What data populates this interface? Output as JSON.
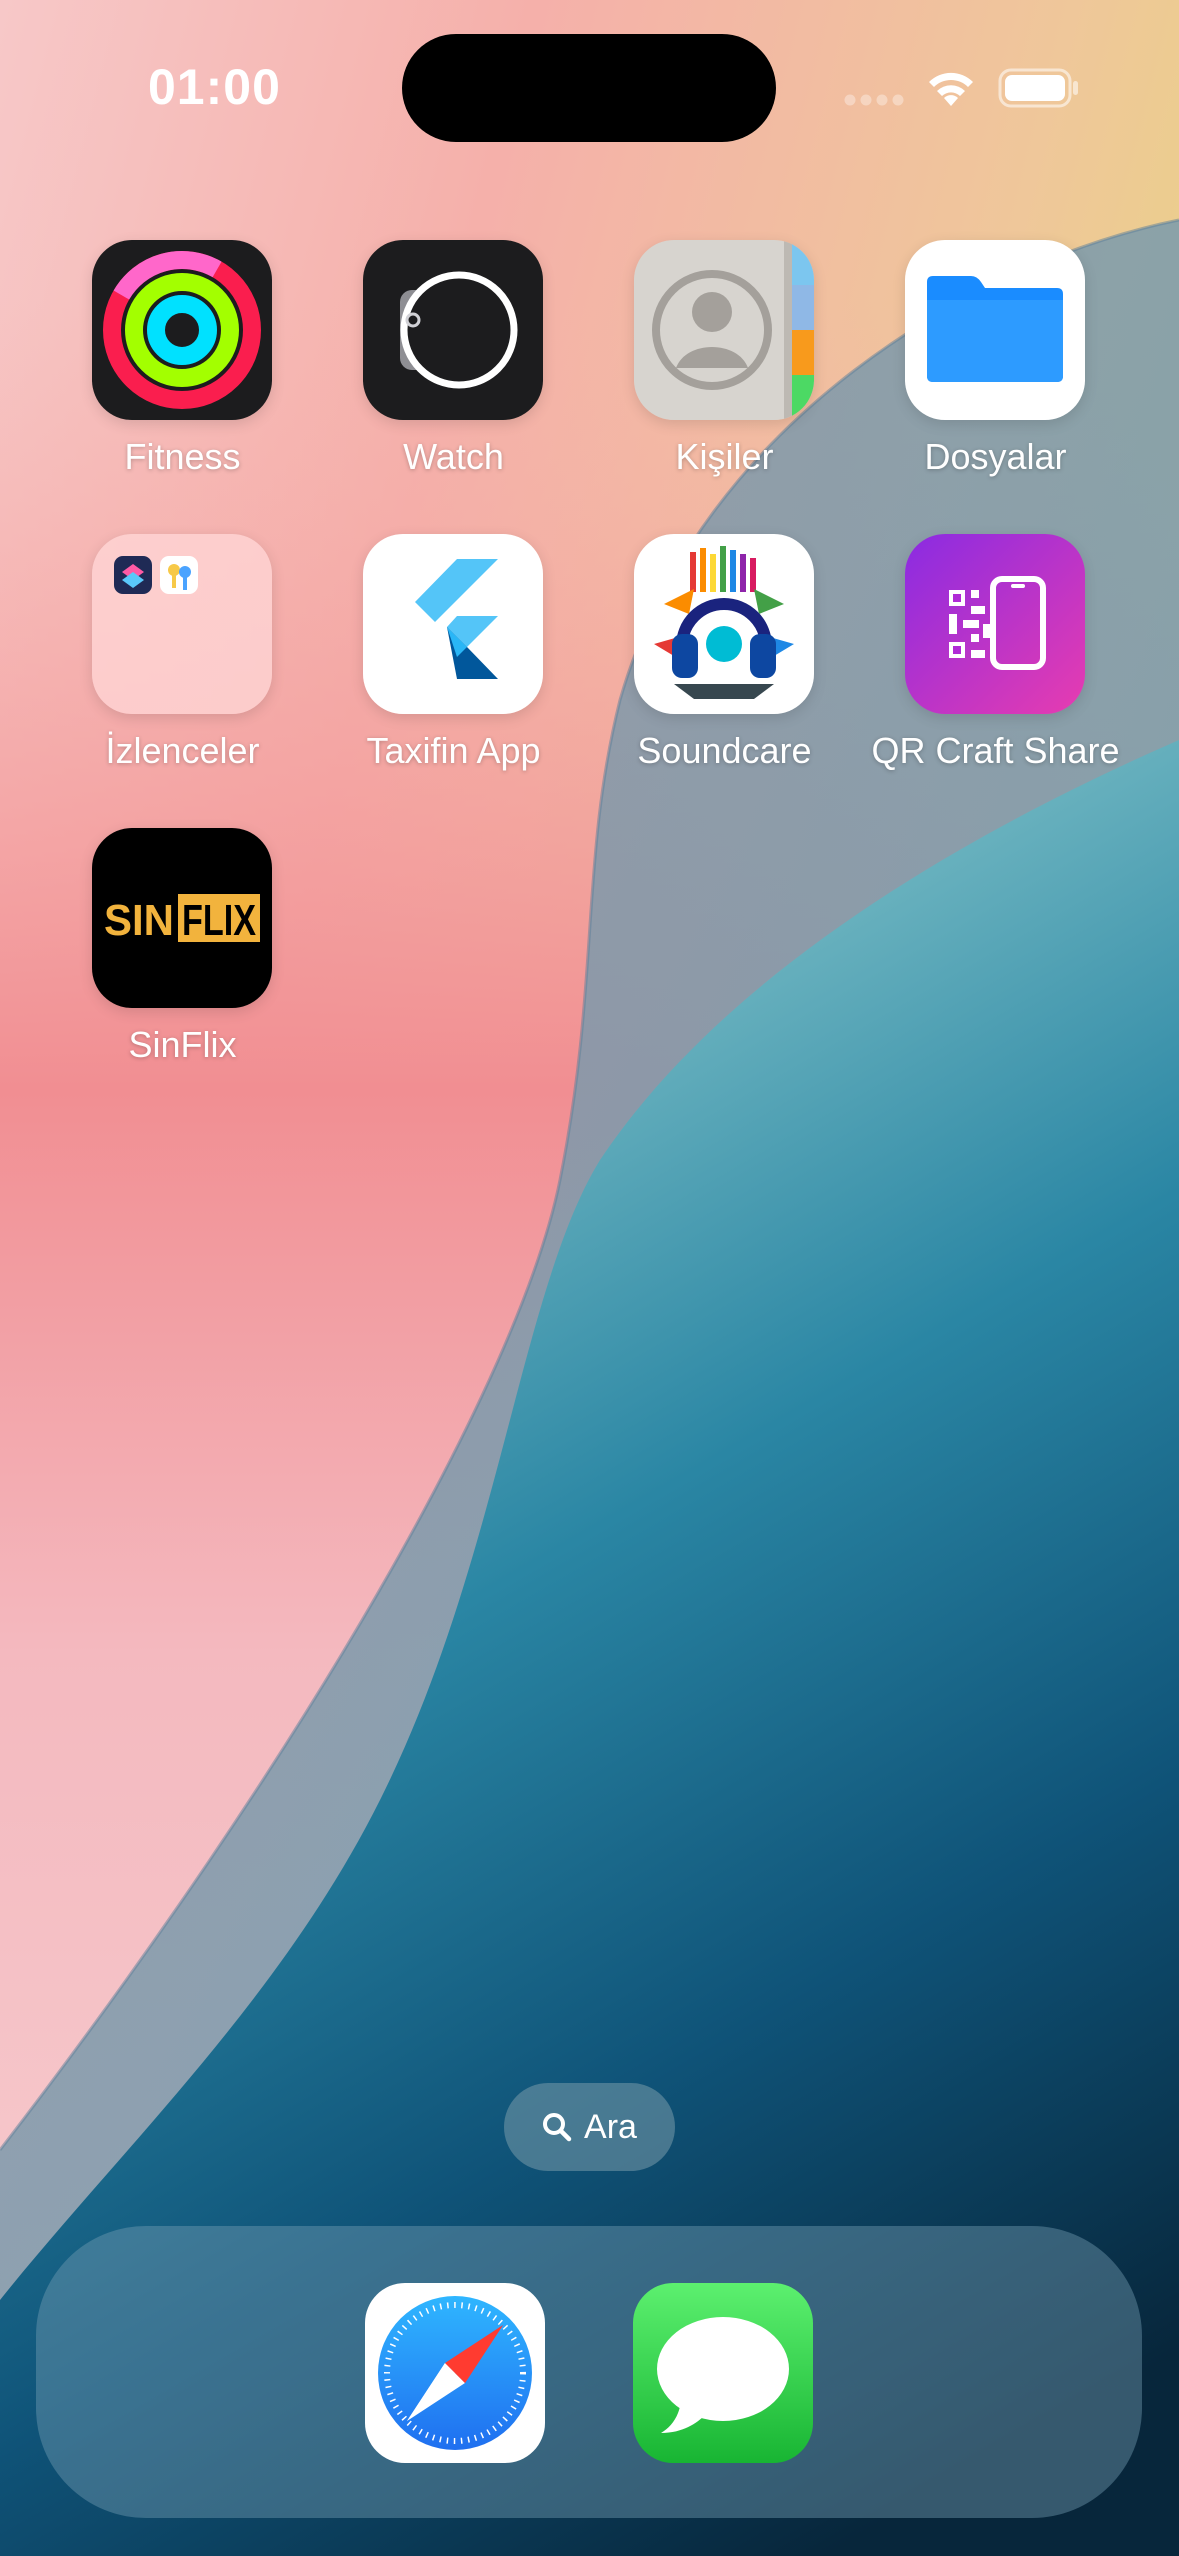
{
  "status_bar": {
    "time": "01:00",
    "signal_icon": "signal-dots-icon",
    "wifi_icon": "wifi-icon",
    "battery_icon": "battery-icon"
  },
  "apps": [
    {
      "label": "Fitness",
      "icon": "fitness-rings-icon"
    },
    {
      "label": "Watch",
      "icon": "watch-icon"
    },
    {
      "label": "Kişiler",
      "icon": "contacts-icon"
    },
    {
      "label": "Dosyalar",
      "icon": "files-folder-icon"
    },
    {
      "label": "İzlenceler",
      "icon": "folder-icon"
    },
    {
      "label": "Taxifin App",
      "icon": "flutter-icon"
    },
    {
      "label": "Soundcare",
      "icon": "headphones-artwork-icon"
    },
    {
      "label": "QR Craft Share",
      "icon": "qr-phone-icon"
    },
    {
      "label": "SinFlix",
      "icon": "sinflix-logo",
      "logo_text": "SINFLIX"
    }
  ],
  "search": {
    "label": "Ara",
    "icon": "search-icon"
  },
  "dock": [
    {
      "name": "Safari",
      "icon": "safari-compass-icon"
    },
    {
      "name": "Messages",
      "icon": "messages-bubble-icon"
    }
  ],
  "colors": {
    "fitness_red": "#fa1e4e",
    "fitness_green": "#a3ff00",
    "fitness_blue": "#00e1ff",
    "files_blue": "#1a8cff",
    "qr_purple": "#b02bd6",
    "sinflix_gold": "#f2b33d",
    "messages_green": "#2fd04a"
  }
}
